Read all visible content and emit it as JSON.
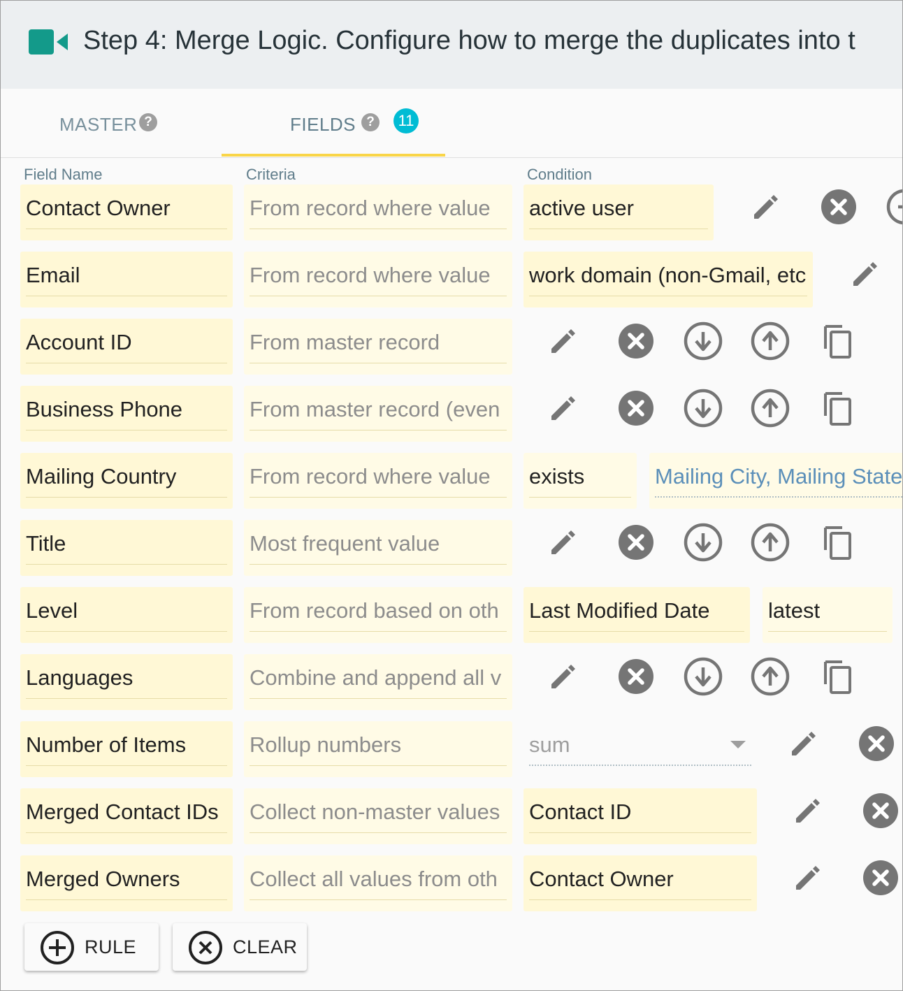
{
  "header": {
    "title": "Step 4: Merge Logic. Configure how to merge the duplicates into t",
    "icon": "video-camera-icon",
    "accent": "#139a8a"
  },
  "tabs": [
    {
      "label": "MASTER",
      "help": "?"
    },
    {
      "label": "FIELDS",
      "help": "?",
      "count": "11",
      "active": true
    }
  ],
  "columns": {
    "field_name": "Field Name",
    "criteria": "Criteria",
    "condition": "Condition"
  },
  "rows": [
    {
      "field": "Contact Owner",
      "criteria": "From record where value",
      "condition": "active user"
    },
    {
      "field": "Email",
      "criteria": "From record where value",
      "condition": "work domain (non-Gmail, etc"
    },
    {
      "field": "Account ID",
      "criteria": "From master record"
    },
    {
      "field": "Business Phone",
      "criteria": "From master record (even"
    },
    {
      "field": "Mailing Country",
      "criteria": "From record where value",
      "condition": "exists",
      "extra": "Mailing City, Mailing State"
    },
    {
      "field": "Title",
      "criteria": "Most frequent value"
    },
    {
      "field": "Level",
      "criteria": "From record based on oth",
      "condition": "Last Modified Date",
      "extra": "latest"
    },
    {
      "field": "Languages",
      "criteria": "Combine and append all v"
    },
    {
      "field": "Number of Items",
      "criteria": "Rollup numbers",
      "condition": "sum"
    },
    {
      "field": "Merged Contact IDs",
      "criteria": "Collect non-master values",
      "condition": "Contact ID"
    },
    {
      "field": "Merged Owners",
      "criteria": "Collect all values from oth",
      "condition": "Contact Owner"
    }
  ],
  "icons": [
    "edit-icon",
    "remove-icon",
    "move-down-icon",
    "move-up-icon",
    "copy-icon"
  ],
  "actions": {
    "add_rule": "RULE",
    "clear": "CLEAR"
  },
  "colors": {
    "tab_indicator": "#f9d548",
    "badge": "#00bcd4",
    "field_bg": "#fff8d6"
  }
}
